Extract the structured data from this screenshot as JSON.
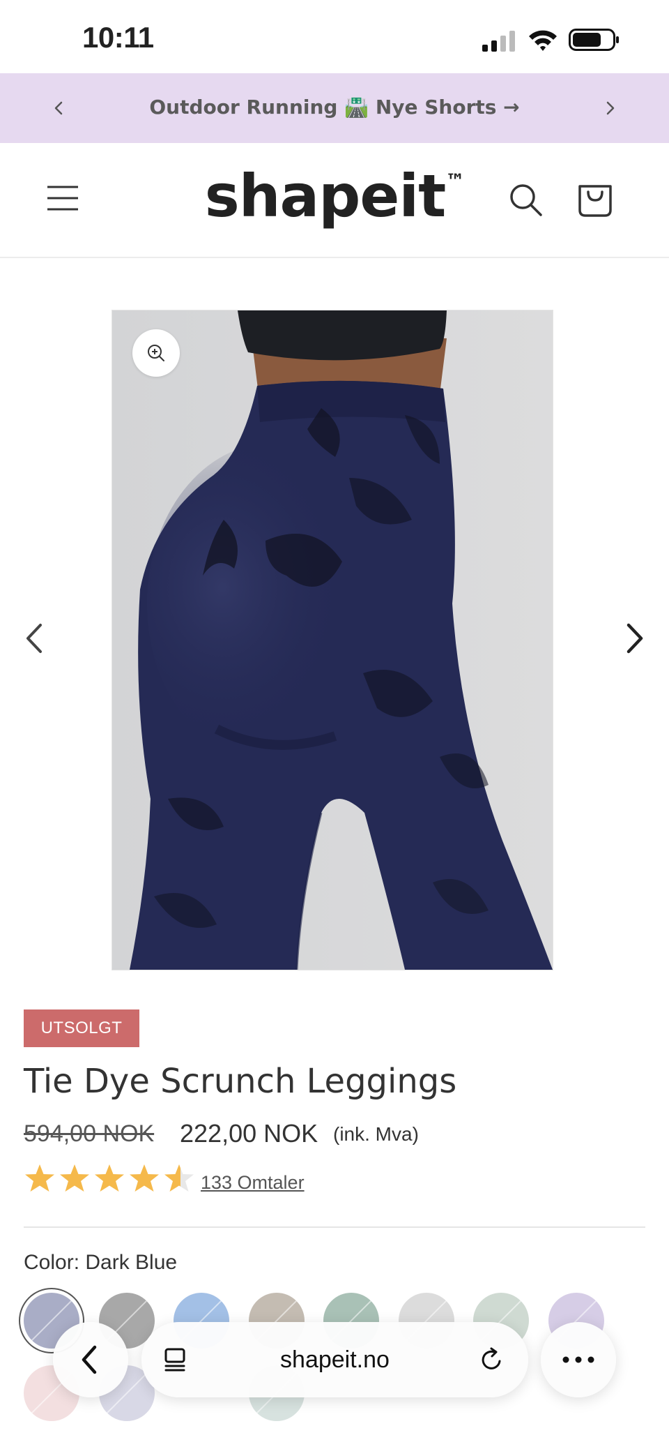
{
  "status_bar": {
    "time": "10:11"
  },
  "announcement": {
    "text": "Outdoor Running 🛣️ Nye Shorts →"
  },
  "header": {
    "logo": "shapeit",
    "logo_mark": "™"
  },
  "product": {
    "badge": "UTSOLGT",
    "title": "Tie Dye Scrunch Leggings",
    "price_old": "594,00 NOK",
    "price_new": "222,00 NOK",
    "tax_note": "(ink. Mva)",
    "rating": 4.5,
    "reviews_link": "133 Omtaler",
    "color_label": "Color: Dark Blue",
    "swatches": [
      {
        "color": "#a9adc6",
        "selected": true
      },
      {
        "color": "#a8a8a8"
      },
      {
        "color": "#a3c0e6"
      },
      {
        "color": "#c4bcb2"
      },
      {
        "color": "#a9c1b6"
      },
      {
        "color": "#dcdcdc"
      },
      {
        "color": "#cfdad2"
      },
      {
        "color": "#d6cde6"
      },
      {
        "color": "#f3dfe0"
      },
      {
        "color": "#d8d8e6"
      },
      {
        "color": "#ffffff"
      },
      {
        "color": "#d7e2df"
      }
    ]
  },
  "browser": {
    "url": "shapeit.no"
  },
  "colors": {
    "announcement_bg": "#e6d9f0",
    "badge_bg": "#cc6b6b",
    "star": "#f5b94b",
    "leggings": "#252a55"
  }
}
